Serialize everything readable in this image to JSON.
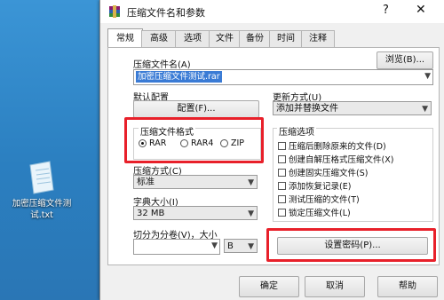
{
  "window": {
    "title": "压缩文件名和参数",
    "help_glyph": "?",
    "close_glyph": "✕"
  },
  "tabs": [
    {
      "label": "常规"
    },
    {
      "label": "高级"
    },
    {
      "label": "选项"
    },
    {
      "label": "文件"
    },
    {
      "label": "备份"
    },
    {
      "label": "时间"
    },
    {
      "label": "注释"
    }
  ],
  "general": {
    "archive_name_label": "压缩文件名(A)",
    "archive_name_value": "加密压缩文件测试.rar",
    "browse_button": "浏览(B)...",
    "default_profile_label": "默认配置",
    "profiles_button": "配置(F)...",
    "update_mode_label": "更新方式(U)",
    "update_mode_value": "添加并替换文件",
    "format_group_label": "压缩文件格式",
    "formats": [
      {
        "label": "RAR",
        "selected": true
      },
      {
        "label": "RAR4",
        "selected": false
      },
      {
        "label": "ZIP",
        "selected": false
      }
    ],
    "method_label": "压缩方式(C)",
    "method_value": "标准",
    "dict_label": "字典大小(I)",
    "dict_value": "32 MB",
    "split_label": "切分为分卷(V)，大小",
    "split_unit_value": "B",
    "options_group_label": "压缩选项",
    "options": [
      {
        "label": "压缩后删除原来的文件(D)"
      },
      {
        "label": "创建自解压格式压缩文件(X)"
      },
      {
        "label": "创建固实压缩文件(S)"
      },
      {
        "label": "添加恢复记录(E)"
      },
      {
        "label": "测试压缩的文件(T)"
      },
      {
        "label": "锁定压缩文件(L)"
      }
    ],
    "set_password_button": "设置密码(P)..."
  },
  "footer": {
    "ok": "确定",
    "cancel": "取消",
    "help": "帮助"
  },
  "desktop": {
    "icon_label": "加密压缩文件测试.txt"
  },
  "colors": {
    "highlight_red": "#e8202a",
    "desktop_blue": "#2f87c9",
    "selection_blue": "#3a7bd5"
  }
}
